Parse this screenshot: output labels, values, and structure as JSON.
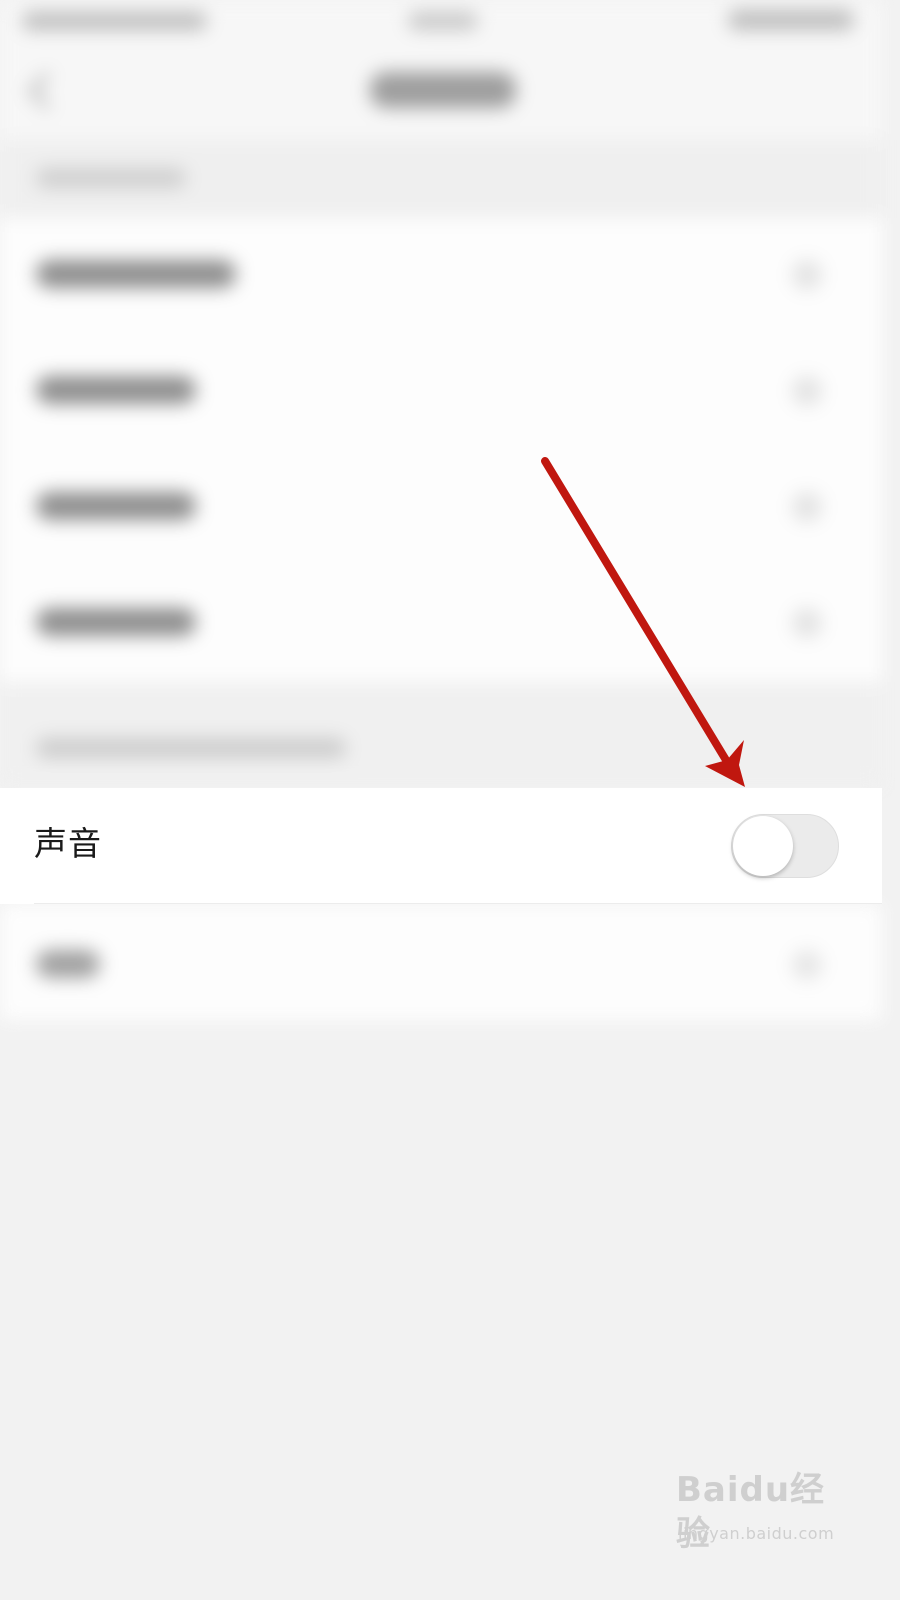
{
  "settings": {
    "sound_label": "声音",
    "sound_enabled": false
  },
  "annotation": {
    "arrow_color": "#c0170f"
  },
  "watermark": {
    "brand": "Baidu经验",
    "url": "jingyan.baidu.com"
  }
}
